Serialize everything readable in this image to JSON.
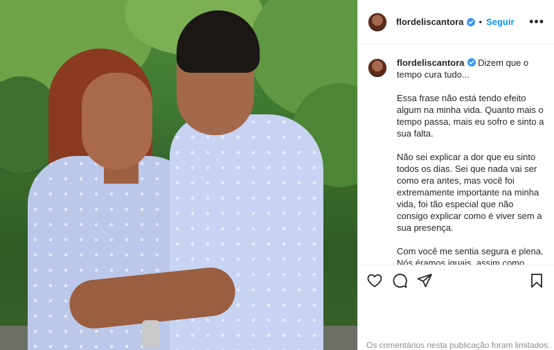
{
  "post": {
    "username": "flordeliscantora",
    "follow_label": "Seguir",
    "separator": "•",
    "more_label": "•••",
    "caption": {
      "first": "Dizem que o tempo cura tudo...",
      "paragraphs": [
        "Essa frase não está tendo efeito algum na minha vida. Quanto mais o tempo passa, mais eu sofro e sinto a sua falta.",
        "Não sei explicar a dor que eu sinto todos os dias. Sei que nada vai ser como era antes, mas você foi extremamente importante na minha vida, foi tão especial que não consigo explicar como é viver sem a sua presença.",
        "Com você me sentia segura e plena. Nós éramos iguais, assim como estamos nessa foto, agarrados um ao outro."
      ]
    },
    "comments_limited": "Os comentários nesta publicação foram limitados.",
    "icons": {
      "like": "heart-icon",
      "comment": "comment-icon",
      "share": "share-icon",
      "save": "bookmark-icon",
      "verified": "verified-badge-icon"
    },
    "colors": {
      "accent": "#0095f6",
      "text": "#262626",
      "muted": "#8e8e8e"
    }
  }
}
